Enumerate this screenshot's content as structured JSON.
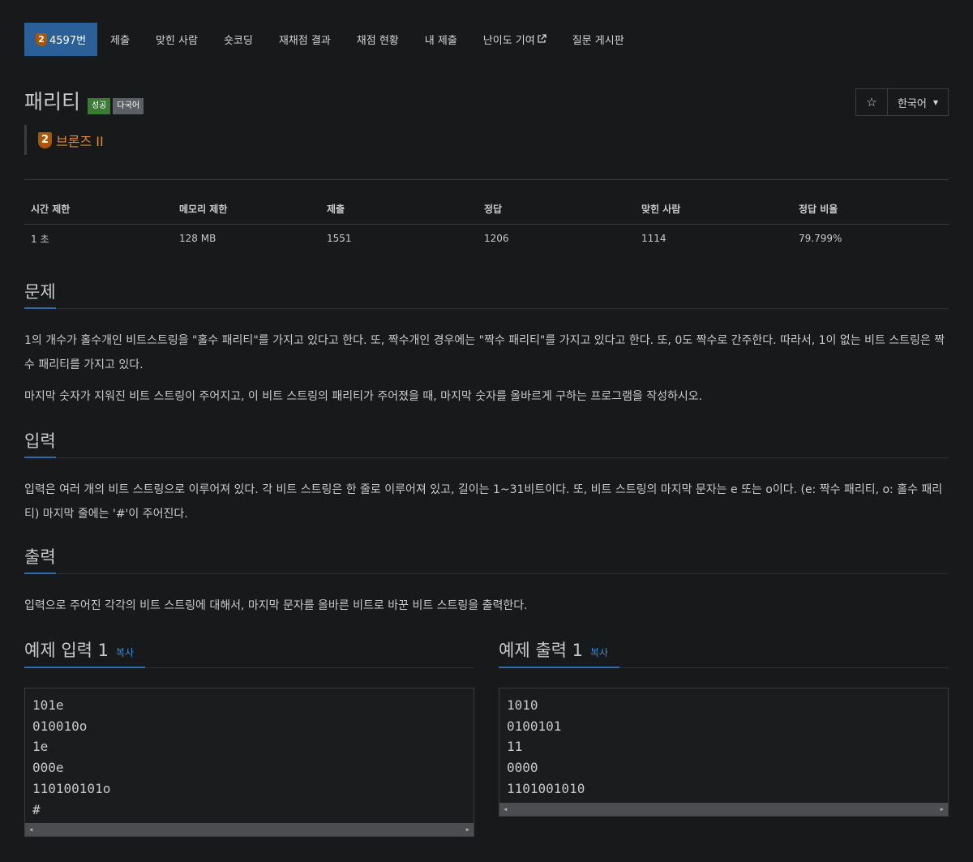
{
  "nav": {
    "problem_id": "4597번",
    "tier_number": "2",
    "items": [
      "제출",
      "맞힌 사람",
      "숏코딩",
      "재채점 결과",
      "채점 현황",
      "내 제출",
      "난이도 기여",
      "질문 게시판"
    ]
  },
  "problem": {
    "title": "패리티",
    "labels": {
      "success": "성공",
      "multilang": "다국어"
    },
    "tier_number": "2",
    "tier_name": "브론즈 II",
    "star": "☆",
    "language": "한국어"
  },
  "stats": {
    "headers": [
      "시간 제한",
      "메모리 제한",
      "제출",
      "정답",
      "맞힌 사람",
      "정답 비율"
    ],
    "values": [
      "1 초",
      "128 MB",
      "1551",
      "1206",
      "1114",
      "79.799%"
    ]
  },
  "sections": {
    "description": {
      "heading": "문제",
      "paragraphs": [
        "1의 개수가 홀수개인 비트스트링을 \"홀수 패리티\"를 가지고 있다고 한다. 또, 짝수개인 경우에는 \"짝수 패리티\"를 가지고 있다고 한다. 또, 0도 짝수로 간주한다. 따라서, 1이 없는 비트 스트링은 짝수 패리티를 가지고 있다.",
        "마지막 숫자가 지워진 비트 스트링이 주어지고, 이 비트 스트링의 패리티가 주어졌을 때, 마지막 숫자를 올바르게 구하는 프로그램을 작성하시오."
      ]
    },
    "input": {
      "heading": "입력",
      "text": "입력은 여러 개의 비트 스트링으로 이루어져 있다. 각 비트 스트링은 한 줄로 이루어져 있고, 길이는 1~31비트이다. 또, 비트 스트링의 마지막 문자는 e 또는 o이다. (e: 짝수 패리티, o: 홀수 패리티) 마지막 줄에는 '#'이 주어진다."
    },
    "output": {
      "heading": "출력",
      "text": "입력으로 주어진 각각의 비트 스트링에 대해서, 마지막 문자를 올바른 비트로 바꾼 비트 스트링을 출력한다."
    }
  },
  "samples": {
    "copy_label": "복사",
    "input": {
      "heading": "예제 입력 1",
      "text": "101e\n010010o\n1e\n000e\n110100101o\n#"
    },
    "output": {
      "heading": "예제 출력 1",
      "text": "1010\n0100101\n11\n0000\n1101001010"
    }
  },
  "colors": {
    "background": "#18191b",
    "nav_active": "#2b5f97",
    "tier_bronze": "#ad5600",
    "tier_text": "#e08a2b",
    "label_success": "#3d7a37",
    "label_multilang": "#5c5f63",
    "accent_underline": "#2b6cb0",
    "copy_link": "#3b8ad9"
  },
  "icons": {
    "external_link": "external-link-icon",
    "star": "star-icon",
    "caret": "caret-down-icon",
    "tier": "bronze-tier-icon"
  }
}
